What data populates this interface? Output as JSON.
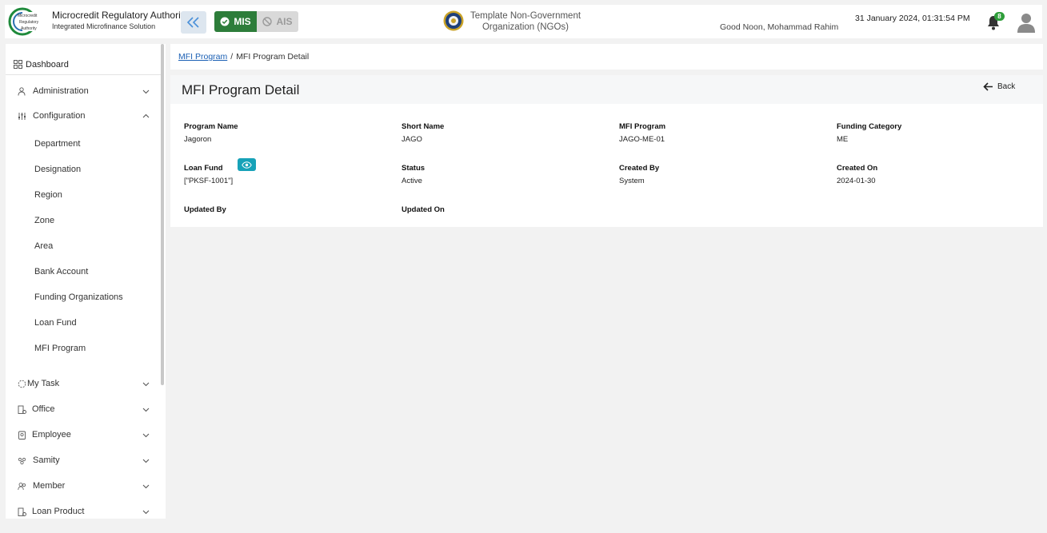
{
  "header": {
    "brand_title": "Microcredit Regulatory Authority",
    "brand_subtitle": "Integrated Microfinance Solution",
    "logo_text": "Microcredit Regulatory Authority",
    "mode_mis": "MIS",
    "mode_ais": "AIS",
    "org_name": "Template Non-Government Organization (NGOs)",
    "greeting": "Good Noon, Mohammad Rahim",
    "datetime": "31 January 2024, 01:31:54 PM",
    "notification_count": "8"
  },
  "sidebar": {
    "dashboard": "Dashboard",
    "administration": "Administration",
    "configuration": "Configuration",
    "config_items": [
      "Department",
      "Designation",
      "Region",
      "Zone",
      "Area",
      "Bank Account",
      "Funding Organizations",
      "Loan Fund",
      "MFI Program"
    ],
    "my_task": "My Task",
    "office": "Office",
    "employee": "Employee",
    "samity": "Samity",
    "member": "Member",
    "loan_product": "Loan Product"
  },
  "breadcrumb": {
    "parent": "MFI Program",
    "separator": "/",
    "current": "MFI Program Detail"
  },
  "page": {
    "title": "MFI Program Detail",
    "back_label": "Back"
  },
  "details": {
    "program_name_label": "Program Name",
    "program_name": "Jagoron",
    "short_name_label": "Short Name",
    "short_name": "JAGO",
    "mfi_program_label": "MFI Program",
    "mfi_program": "JAGO-ME-01",
    "funding_category_label": "Funding Category",
    "funding_category": "ME",
    "loan_fund_label": "Loan Fund",
    "loan_fund": "[\"PKSF-1001\"]",
    "status_label": "Status",
    "status": "Active",
    "created_by_label": "Created By",
    "created_by": "System",
    "created_on_label": "Created On",
    "created_on": "2024-01-30",
    "updated_by_label": "Updated By",
    "updated_on_label": "Updated On"
  },
  "colors": {
    "mis_active": "#2d7d3a",
    "ais_inactive": "#d9d9d9",
    "eye_button": "#17a2b8",
    "link": "#1a5fb4",
    "badge": "#2e9e3a"
  }
}
